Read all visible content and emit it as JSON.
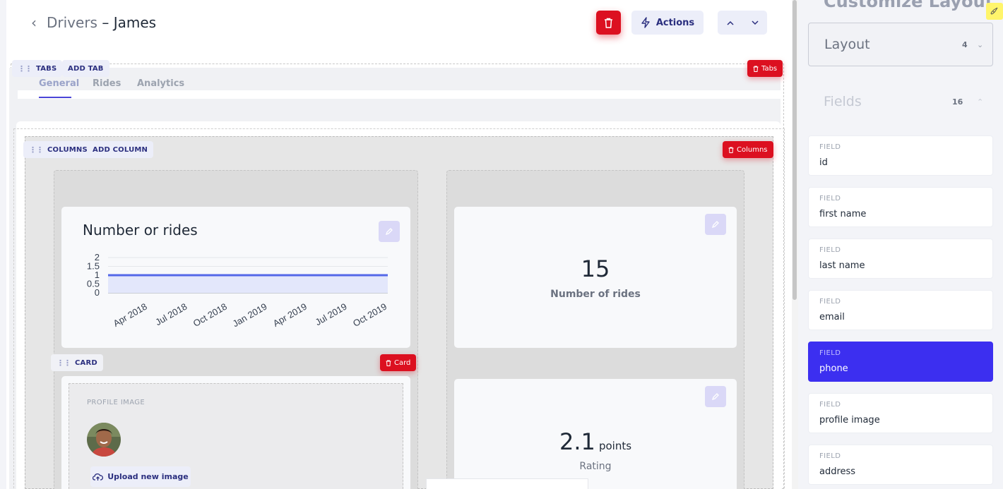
{
  "header": {
    "breadcrumb": "Drivers",
    "separator": "–",
    "record_name": "James",
    "actions_label": "Actions"
  },
  "tabs_block": {
    "chip_label": "TABS",
    "add_label": "ADD TAB",
    "delete_label": "Tabs",
    "tabs": [
      "General",
      "Rides",
      "Analytics"
    ],
    "active_tab": "General"
  },
  "columns_block": {
    "chip_label": "COLUMNS",
    "add_label": "ADD COLUMN",
    "delete_label": "Columns"
  },
  "card_block": {
    "chip_label": "CARD",
    "delete_label": "Card"
  },
  "chart_card": {
    "title": "Number or rides"
  },
  "chart_data": {
    "type": "area",
    "title": "Number or rides",
    "x": [
      "Apr 2018",
      "Jul 2018",
      "Oct 2018",
      "Jan 2019",
      "Apr 2019",
      "Jul 2019",
      "Oct 2019"
    ],
    "y": [
      1,
      1,
      1,
      1,
      1,
      1,
      1
    ],
    "yticks": [
      "2",
      "1.5",
      "1",
      "0.5",
      "0"
    ],
    "ylim": [
      0,
      2
    ],
    "grid": true,
    "line_color": "#5468e8",
    "fill_color": "#e3e7fb"
  },
  "metric_rides": {
    "value": "15",
    "label": "Number of rides"
  },
  "metric_rating": {
    "value": "2.1",
    "unit": "points",
    "label": "Rating"
  },
  "profile": {
    "label": "PROFILE IMAGE",
    "upload_label": "Upload new image"
  },
  "sidebar": {
    "title": "Customize Layout",
    "layout_label": "Layout",
    "layout_count": "4",
    "fields_label": "Fields",
    "fields_count": "16",
    "field_caption": "FIELD",
    "fields": [
      "id",
      "first name",
      "last name",
      "email",
      "phone",
      "profile image",
      "address"
    ],
    "selected_field": "phone"
  },
  "colors": {
    "danger": "#dc1020",
    "accent": "#3c2ff0",
    "chip_bg": "#eceef9"
  }
}
